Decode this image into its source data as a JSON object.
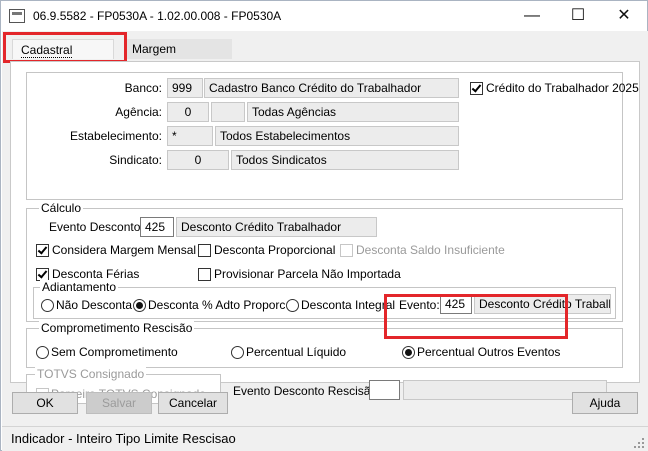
{
  "window": {
    "title": "06.9.5582 - FP0530A - 1.02.00.008 - FP0530A",
    "minimize_glyph": "—",
    "maximize_glyph": "☐",
    "close_glyph": "✕"
  },
  "tabs": [
    {
      "label": "Cadastral",
      "active": true
    },
    {
      "label": "Margem",
      "active": false
    }
  ],
  "header": {
    "banco": {
      "label": "Banco:",
      "code": "999",
      "desc": "Cadastro Banco Crédito do Trabalhador"
    },
    "agencia": {
      "label": "Agência:",
      "code": "0",
      "code2": "",
      "desc": "Todas Agências"
    },
    "estabelecimento": {
      "label": "Estabelecimento:",
      "code": "*",
      "desc": "Todos Estabelecimentos"
    },
    "sindicato": {
      "label": "Sindicato:",
      "code": "0",
      "desc": "Todos Sindicatos"
    },
    "credito_check": {
      "label": "Crédito do Trabalhador 2025",
      "checked": true
    }
  },
  "calculo": {
    "title": "Cálculo",
    "evento_desconto": {
      "label": "Evento Desconto:",
      "code": "425",
      "desc": "Desconto Crédito Trabalhador"
    },
    "considera_margem": {
      "label": "Considera Margem Mensal",
      "checked": true
    },
    "desconta_proporcional": {
      "label": "Desconta Proporcional",
      "checked": false
    },
    "desconta_saldo": {
      "label": "Desconta Saldo Insuficiente",
      "checked": false,
      "disabled": true
    },
    "desconta_ferias": {
      "label": "Desconta Férias",
      "checked": true
    },
    "provisionar": {
      "label": "Provisionar Parcela Não Importada",
      "checked": false
    },
    "adiantamento": {
      "title": "Adiantamento",
      "options": [
        {
          "label": "Não Desconta",
          "selected": false
        },
        {
          "label": "Desconta % Adto Proporc",
          "selected": true
        },
        {
          "label": "Desconta Integral",
          "selected": false
        }
      ],
      "evento": {
        "label": "Evento:",
        "code": "425",
        "desc": "Desconto Crédito Trabalha"
      }
    }
  },
  "comprometimento": {
    "title": "Comprometimento Rescisão",
    "options": [
      {
        "label": "Sem Comprometimento",
        "selected": false
      },
      {
        "label": "Percentual Líquido",
        "selected": false
      },
      {
        "label": "Percentual Outros Eventos",
        "selected": true
      }
    ]
  },
  "totvs": {
    "title": "TOTVS Consignado",
    "parceiro": {
      "label": "Parceiro TOTVS Consignado",
      "checked": false,
      "disabled": true
    }
  },
  "evento_rescisao": {
    "label": "Evento Desconto Rescisão:",
    "code": "",
    "desc": ""
  },
  "buttons": {
    "ok": "OK",
    "salvar": "Salvar",
    "cancelar": "Cancelar",
    "ajuda": "Ajuda"
  },
  "status": {
    "text": "Indicador - Inteiro Tipo Limite Rescisao"
  },
  "colors": {
    "highlight": "#e3262a",
    "panel_bg": "#f0f0f0"
  }
}
